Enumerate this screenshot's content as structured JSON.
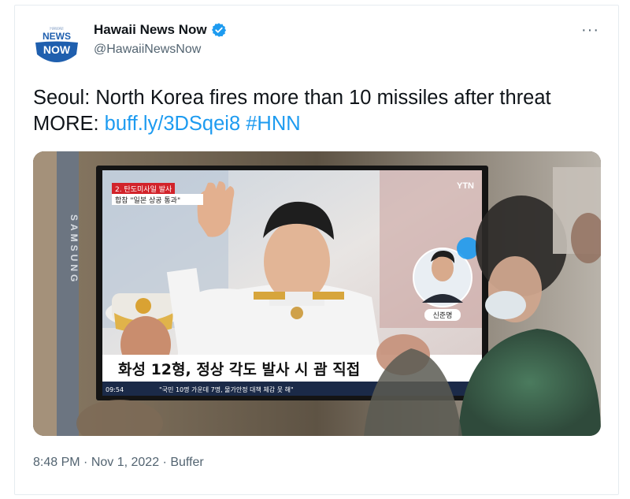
{
  "author": {
    "name": "Hawaii News Now",
    "handle": "@HawaiiNewsNow",
    "avatar_logo": {
      "top": "HAWAII",
      "line1": "NEWS",
      "line2": "NOW"
    }
  },
  "more_label": "···",
  "tweet": {
    "text_main": "Seoul: North Korea fires more than 10 missiles after threat MORE: ",
    "link": "buff.ly/3DSqei8",
    "hashtag": "#HNN"
  },
  "media": {
    "tv_logo": "YTN",
    "banner_top": "2. 탄도미사일 발사",
    "banner_sub": "합참 \"일본 상공 통과\"",
    "caption": "화성 12형, 정상 각도 발사 시 괌 직접",
    "ticker_time": "09:54",
    "ticker_text": "\"국민 10명 가운데 7명, 물가안정 대책 체감 못 해\"",
    "reporter_name": "신준명",
    "side_brand": "SAMSUNG"
  },
  "footer": {
    "time": "8:48 PM",
    "sep1": " · ",
    "date": "Nov 1, 2022",
    "sep2": " · ",
    "source": "Buffer"
  },
  "colors": {
    "brand_blue": "#1d9bf0",
    "text": "#0f1419",
    "muted": "#536471",
    "logo_blue": "#1f5fae"
  }
}
